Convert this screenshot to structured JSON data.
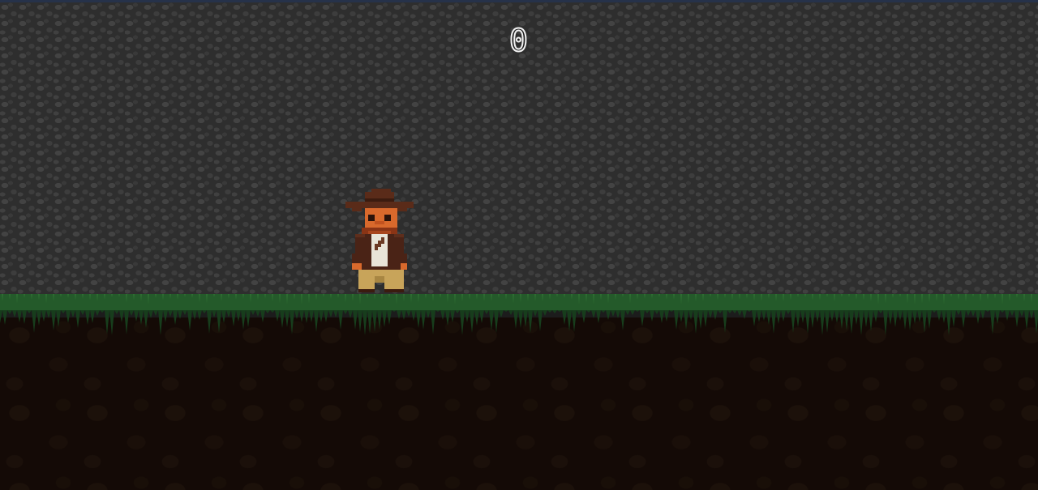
{
  "hud": {
    "score": "0"
  },
  "scene": {
    "player": "explorer-with-fedora",
    "wall_texture": "grey-cobblestone",
    "ground_texture": "dark-soil-with-grass",
    "colors": {
      "wall": "#2e2e2e",
      "wall_stone": "#434343",
      "grass": "#245a2a",
      "grass_dark": "#173d1c",
      "soil": "#140a06",
      "score_outline": "#f2f2f2",
      "hat": "#5a2b19",
      "skin": "#d9692c",
      "jacket": "#4a2316",
      "shirt": "#e8e4d8",
      "trousers": "#c8a45a"
    }
  }
}
